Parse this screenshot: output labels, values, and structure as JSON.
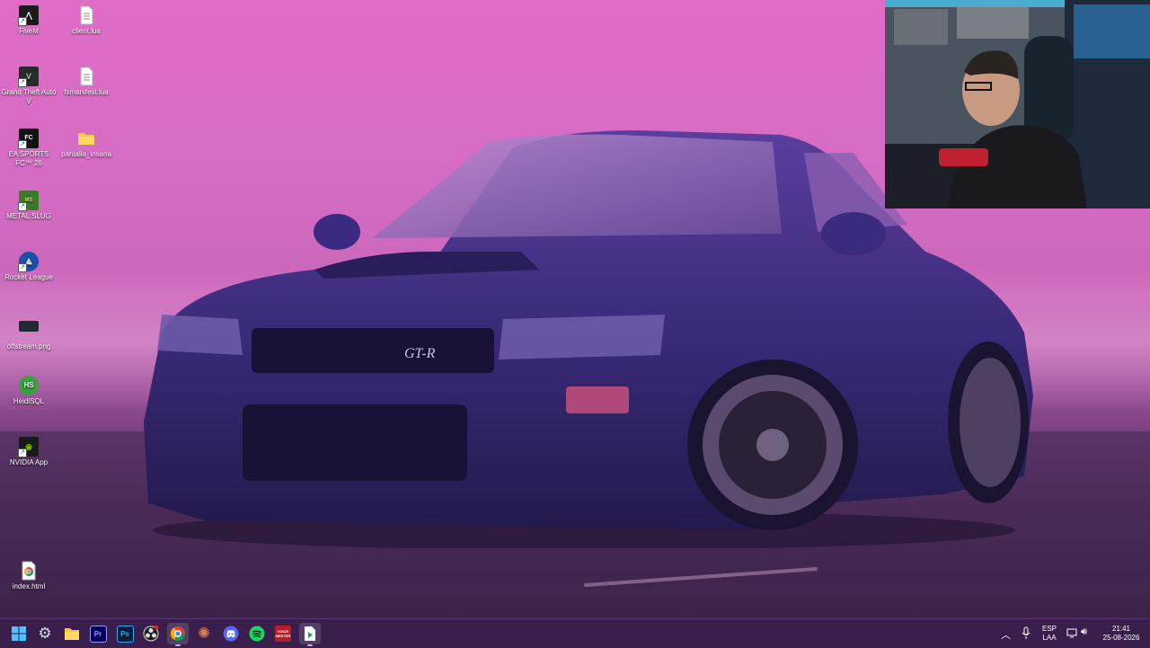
{
  "desktop": {
    "icons": [
      {
        "label": "FiveM",
        "icon": "fivem-icon",
        "color": "#1b1b1b"
      },
      {
        "label": "client.lua",
        "icon": "text-file-icon",
        "color": "#ffffff"
      },
      {
        "label": "Grand Theft Auto V",
        "icon": "gta5-icon",
        "color": "#2b2b2b"
      },
      {
        "label": "fxmanifest.lua",
        "icon": "text-file-icon",
        "color": "#ffffff"
      },
      {
        "label": "EA SPORTS FC™ 26",
        "icon": "ea-fc-icon",
        "color": "#111111"
      },
      {
        "label": "pantalla_insana",
        "icon": "folder-icon",
        "color": "#f5c542"
      },
      {
        "label": "METAL SLUG",
        "icon": "metal-slug-icon",
        "color": "#3c7a2a"
      },
      {
        "label": "Rocket League",
        "icon": "rocket-league-icon",
        "color": "#1c4fa8"
      },
      {
        "label": "offstream.png",
        "icon": "image-file-icon",
        "color": "#222a33"
      },
      {
        "label": "HeidiSQL",
        "icon": "heidisql-icon",
        "color": "#3aa040"
      },
      {
        "label": "NVIDIA App",
        "icon": "nvidia-icon",
        "color": "#76b900"
      },
      {
        "label": "index.html",
        "icon": "chrome-html-file-icon",
        "color": "#ffffff"
      }
    ],
    "wallpaper_badge": "GT-R"
  },
  "taskbar": {
    "apps": [
      {
        "name": "start-button",
        "icon": "windows-icon"
      },
      {
        "name": "settings",
        "icon": "gear-icon"
      },
      {
        "name": "file-explorer",
        "icon": "folder-icon"
      },
      {
        "name": "premiere-pro",
        "icon": "premiere-icon",
        "text": "Pr"
      },
      {
        "name": "photoshop",
        "icon": "photoshop-icon",
        "text": "Ps"
      },
      {
        "name": "obs-studio",
        "icon": "obs-icon"
      },
      {
        "name": "chrome",
        "icon": "chrome-icon"
      },
      {
        "name": "claude",
        "icon": "sunburst-icon"
      },
      {
        "name": "discord",
        "icon": "discord-icon"
      },
      {
        "name": "spotify",
        "icon": "spotify-icon"
      },
      {
        "name": "voicemeeter",
        "icon": "voicemeeter-icon",
        "text": "VOICE\nMEETER"
      },
      {
        "name": "active-app",
        "icon": "green-arrow-icon"
      }
    ],
    "tray": {
      "language_top": "ESP",
      "language_bottom": "LAA",
      "time": "21:41",
      "date": "25-08-2026"
    }
  },
  "colors": {
    "taskbar": "#3a1f4c",
    "car_body": "#3b2a7a",
    "sky": "#e06cc6"
  }
}
